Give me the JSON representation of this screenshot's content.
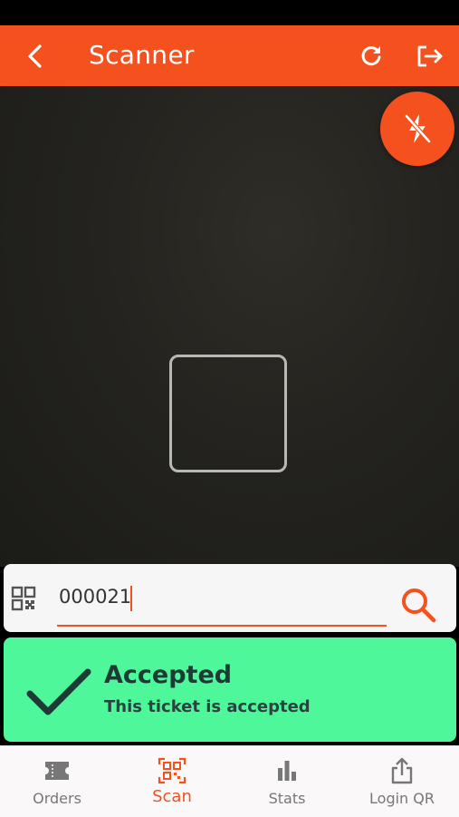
{
  "app_bar": {
    "title": "Scanner",
    "icons": [
      "back-arrow-icon",
      "refresh-icon",
      "logout-icon"
    ]
  },
  "camera": {
    "flash_icon": "flash-off-icon"
  },
  "search": {
    "value": "000021",
    "icons": [
      "qr-code-icon",
      "search-icon"
    ]
  },
  "result": {
    "title": "Accepted",
    "message": "This ticket is accepted",
    "icon": "checkmark-icon"
  },
  "bottom_nav": {
    "items": [
      {
        "label": "Orders",
        "icon": "ticket-icon",
        "active": false
      },
      {
        "label": "Scan",
        "icon": "qr-scan-icon",
        "active": true
      },
      {
        "label": "Stats",
        "icon": "bar-chart-icon",
        "active": false
      },
      {
        "label": "Login QR",
        "icon": "share-icon",
        "active": false
      }
    ]
  },
  "colors": {
    "accent": "#f4511e",
    "success": "#4ef799",
    "inactive_nav": "#777777"
  }
}
